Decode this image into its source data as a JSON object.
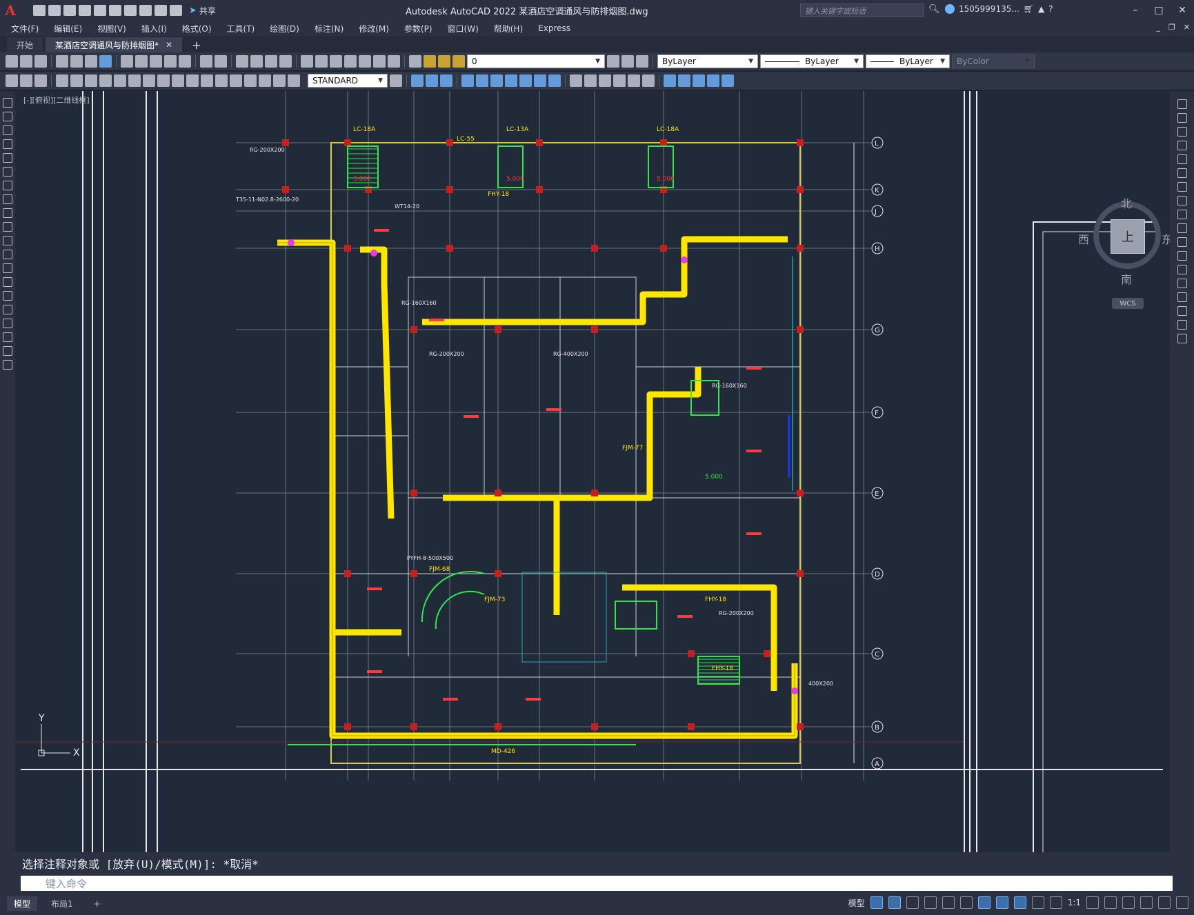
{
  "app": {
    "title": "Autodesk AutoCAD 2022    某酒店空调通风与防排烟图.dwg",
    "logo": "A",
    "share_label": "共享",
    "search_placeholder": "键入关键字或短语",
    "user_name": "1505999135...",
    "window_controls": [
      "–",
      "□",
      "✕"
    ]
  },
  "menu": [
    "文件(F)",
    "编辑(E)",
    "视图(V)",
    "插入(I)",
    "格式(O)",
    "工具(T)",
    "绘图(D)",
    "标注(N)",
    "修改(M)",
    "参数(P)",
    "窗口(W)",
    "帮助(H)",
    "Express"
  ],
  "tabs": {
    "start": "开始",
    "active": "某酒店空调通风与防排烟图*",
    "close": "✕",
    "add": "+"
  },
  "toolbar1": {
    "layer": "0",
    "color": "ByLayer",
    "linetype": "ByLayer",
    "lineweight": "ByLayer",
    "plotstyle": "ByColor"
  },
  "toolbar2": {
    "textstyle": "STANDARD"
  },
  "viewport": {
    "label": "[-][俯视][二维线框]",
    "viewcube": {
      "north": "北",
      "south": "南",
      "east": "东",
      "west": "西",
      "face": "上",
      "wcs": "WCS"
    },
    "ucs_x": "X",
    "ucs_y": "Y"
  },
  "drawing": {
    "grid_labels_right": [
      "L",
      "K",
      "J",
      "H",
      "G",
      "F",
      "E",
      "D",
      "C",
      "B",
      "A"
    ],
    "equipment_labels": [
      "LC-18A",
      "LC-13A",
      "LC-18A",
      "LC-55",
      "FHY-18",
      "FJM-68",
      "FJM-73",
      "FHY-18",
      "FHY-18",
      "MD-426",
      "FJM-77"
    ],
    "level_marks": [
      "5.000",
      "5.000",
      "5.000",
      "5.000"
    ],
    "annotations": [
      "RG-200X200",
      "RG-160X160",
      "RG-400X200",
      "RG-200X200",
      "PYFH-8-500X500",
      "WT14-20",
      "T35-11-N02.8-2600-20",
      "RG-160X160",
      "RG-200X200",
      "400X200"
    ]
  },
  "command": {
    "history": "选择注释对象或 [放弃(U)/模式(M)]: *取消*",
    "placeholder": "键入命令"
  },
  "statusbar": {
    "tabs": [
      "模型",
      "布局1"
    ],
    "add": "+",
    "mode": "模型",
    "scale": "1:1"
  }
}
